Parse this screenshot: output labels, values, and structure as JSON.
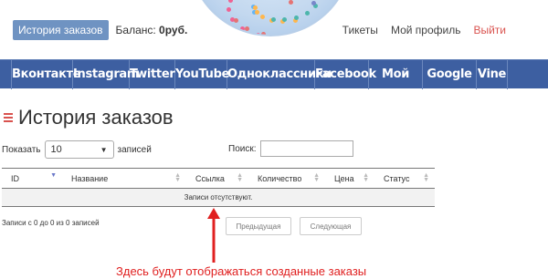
{
  "header": {
    "orders_button": "История заказов",
    "balance_label": "Баланс:",
    "balance_value": "0руб.",
    "links": {
      "tickets": "Тикеты",
      "profile": "Мой профиль",
      "logout": "Выйти"
    }
  },
  "nav": {
    "items": [
      "Вконтакте",
      "Instagram",
      "Twitter",
      "YouTube",
      "Одноклассники",
      "Facebook",
      "Мой Мир",
      "Google +",
      "Vine"
    ]
  },
  "page": {
    "title": "История заказов"
  },
  "controls": {
    "show_label": "Показать",
    "page_size": "10",
    "records_label": "записей",
    "search_label": "Поиск:",
    "search_value": ""
  },
  "table": {
    "columns": [
      "ID",
      "Название",
      "Ссылка",
      "Количество",
      "Цена",
      "Статус"
    ],
    "empty_message": "Записи отсутствуют."
  },
  "pagination": {
    "info": "Записи с 0 до 0 из 0 записей",
    "prev": "Предыдущая",
    "next": "Следующая"
  },
  "annotation": {
    "note": "Здесь будут отображаться созданные заказы"
  },
  "colors": {
    "nav_bg": "#3d5fa1",
    "accent_button": "#6f93c2",
    "logout": "#d9534f",
    "annotation": "#e02020"
  }
}
